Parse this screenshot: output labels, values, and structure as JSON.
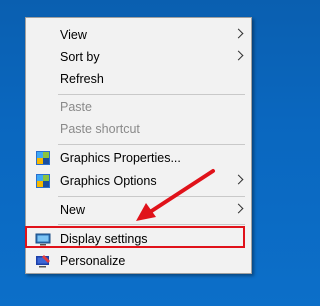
{
  "context_menu": {
    "items": [
      {
        "label": "View",
        "submenu": true
      },
      {
        "label": "Sort by",
        "submenu": true
      },
      {
        "label": "Refresh"
      },
      {
        "label": "Paste",
        "disabled": true
      },
      {
        "label": "Paste shortcut",
        "disabled": true
      },
      {
        "label": "Graphics Properties...",
        "icon": "intel-graphics-icon"
      },
      {
        "label": "Graphics Options",
        "submenu": true,
        "icon": "intel-graphics-icon"
      },
      {
        "label": "New",
        "submenu": true
      },
      {
        "label": "Display settings",
        "icon": "display-settings-icon",
        "highlighted": true
      },
      {
        "label": "Personalize",
        "icon": "personalize-icon"
      }
    ]
  },
  "annotation": {
    "color": "#e0121a"
  }
}
